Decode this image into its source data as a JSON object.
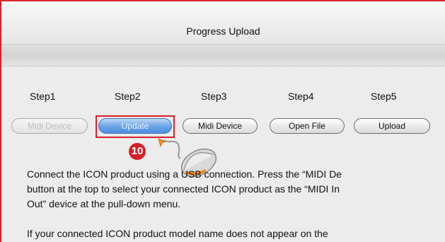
{
  "window": {
    "title": "Progress Upload"
  },
  "steps": [
    {
      "label": "Step1",
      "button": "Midi Device",
      "state": "disabled"
    },
    {
      "label": "Step2",
      "button": "Update",
      "state": "active"
    },
    {
      "label": "Step3",
      "button": "Midi Device",
      "state": "normal"
    },
    {
      "label": "Step4",
      "button": "Open File",
      "state": "normal"
    },
    {
      "label": "Step5",
      "button": "Upload",
      "state": "normal"
    }
  ],
  "annotation": {
    "badge": "10"
  },
  "instructions": {
    "line1": "Connect the ICON product using a USB connection. Press the “MIDI De",
    "line2": "button at the top to select your connected ICON product as the “MIDI In",
    "line3": "Out” device at the pull-down menu.",
    "line4": "If your connected ICON product model name does not appear on the"
  },
  "colors": {
    "highlight": "#d8222a",
    "active_button": "#6ea6e6",
    "badge": "#d51f26"
  },
  "icons": [
    "mouse-icon"
  ]
}
